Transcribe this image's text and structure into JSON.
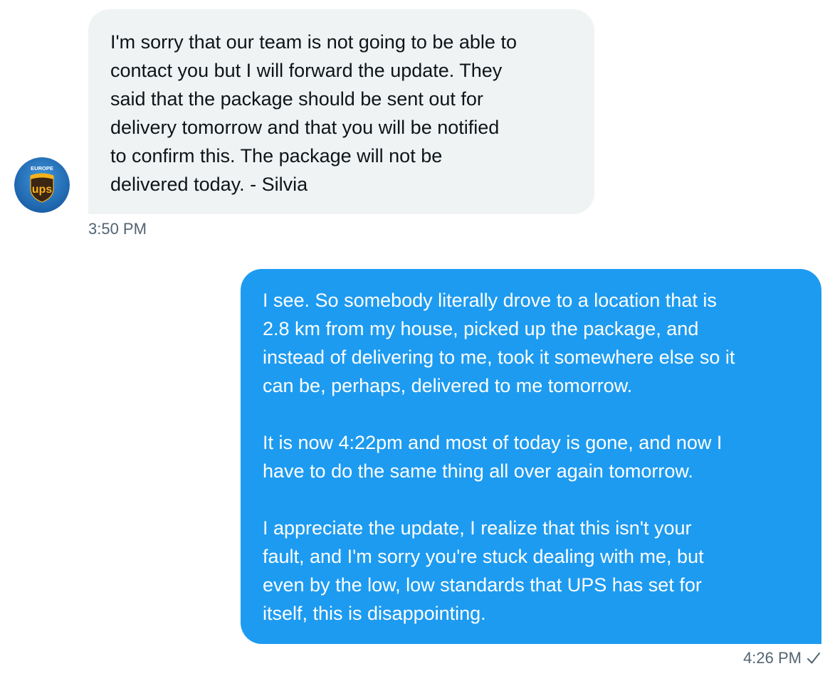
{
  "conversation": {
    "incoming": {
      "avatar": {
        "icon": "ups-europe-logo-icon",
        "text_top": "EUROPE",
        "logo_text": "ups",
        "colors": {
          "ring": "#1f6fb8",
          "shield": "#3b2513",
          "logo_text": "#f5b21c"
        }
      },
      "text": "I'm sorry that our team is not going to be able to\ncontact you but I will forward the update. They\nsaid that the package should be sent out for\ndelivery tomorrow and that you will be notified\nto confirm this. The package will not be\ndelivered today. - Silvia",
      "time": "3:50 PM"
    },
    "outgoing": {
      "paragraphs": [
        "I see. So somebody literally drove to a location that is\n2.8 km from my house, picked up the package, and\ninstead of delivering to me, took it somewhere else so it\ncan be, perhaps, delivered to me tomorrow.",
        "It is now 4:22pm and most of today is gone, and now I\nhave to do the same thing all over again tomorrow.",
        "I appreciate the update, I realize that this isn't your\nfault, and I'm sorry you're stuck dealing with me, but\neven by the low, low standards that UPS has set for\nitself, this is disappointing."
      ],
      "time": "4:26 PM",
      "status_icon": "check-icon"
    }
  },
  "colors": {
    "incoming_bubble": "#eff3f4",
    "outgoing_bubble": "#1d9bf0",
    "timestamp": "#536471"
  }
}
